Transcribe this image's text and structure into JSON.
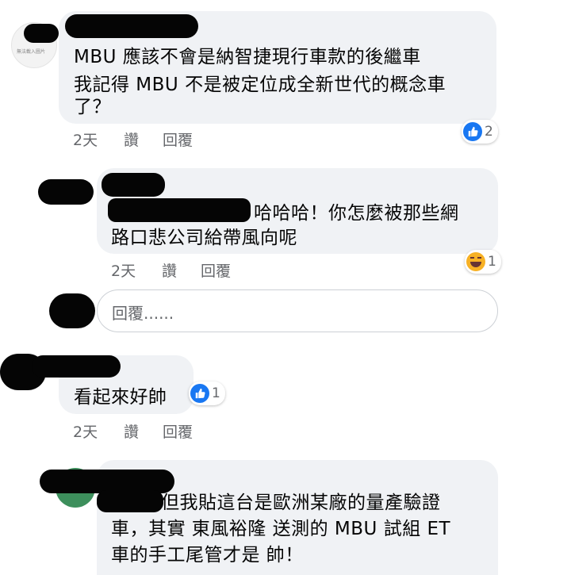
{
  "comments": [
    {
      "lines": [
        "MBU 應該不會是納智捷現行車款的後繼車",
        "我記得 MBU 不是被定位成全新世代的概念車",
        "了？"
      ],
      "time": "2天",
      "like": "讚",
      "reply": "回覆",
      "reaction": {
        "icon": "like-icon",
        "count": "2"
      },
      "avatar_text": "無法載入圖片"
    },
    {
      "lines": [
        "哈哈哈！你怎麼被那些網",
        "路口悲公司給帶風向呢"
      ],
      "time": "2天",
      "like": "讚",
      "reply": "回覆",
      "reaction": {
        "icon": "haha-icon",
        "count": "1"
      }
    },
    {
      "lines": [
        "看起來好帥"
      ],
      "time": "2天",
      "like": "讚",
      "reply": "回覆",
      "reaction": {
        "icon": "like-icon",
        "count": "1"
      }
    },
    {
      "lines": [
        "但我貼這台是歐洲某廠的量產驗證",
        "車，其實 東風裕隆 送測的 MBU 試組 ET",
        "車的手工尾管才是 帥！"
      ]
    }
  ],
  "reply_input": {
    "placeholder": "回覆......"
  },
  "colors": {
    "bubble": "#f0f2f5",
    "meta": "#65676b",
    "like_blue": "#1877f2",
    "haha_yellow": "#f7b125"
  }
}
